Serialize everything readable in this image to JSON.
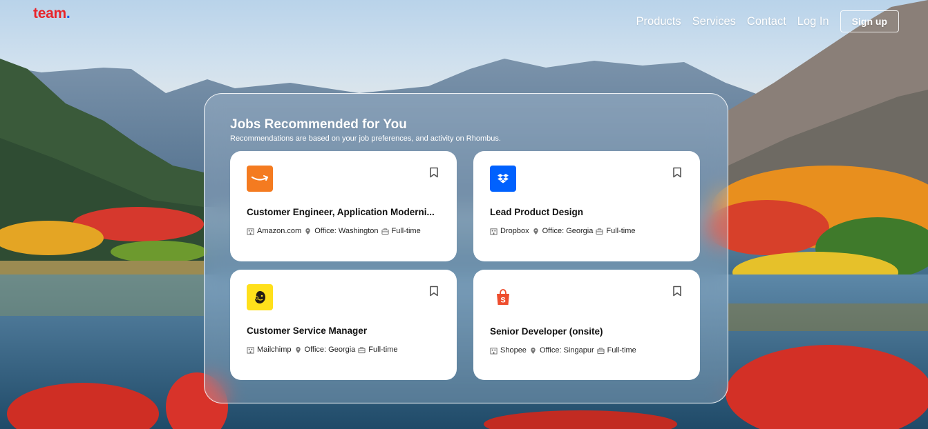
{
  "brand": {
    "name": "team",
    "dot": "."
  },
  "nav": {
    "items": [
      "Products",
      "Services",
      "Contact",
      "Log In"
    ],
    "signup": "Sign up"
  },
  "section": {
    "title": "Jobs Recommended for You",
    "subtitle": "Recommendations are based on your job preferences, and activity on Rhombus."
  },
  "jobs": [
    {
      "title": "Customer Engineer, Application Moderni...",
      "company": "Amazon.com",
      "location": "Office: Washington",
      "type": "Full-time",
      "logo": "amazon-logo-icon",
      "logo_bg": "#f47b20"
    },
    {
      "title": "Lead Product Design",
      "company": "Dropbox",
      "location": "Office: Georgia",
      "type": "Full-time",
      "logo": "dropbox-logo-icon",
      "logo_bg": "#0061fe"
    },
    {
      "title": "Customer Service Manager",
      "company": "Mailchimp",
      "location": "Office: Georgia",
      "type": "Full-time",
      "logo": "mailchimp-logo-icon",
      "logo_bg": "#ffe01b"
    },
    {
      "title": "Senior Developer (onsite)",
      "company": "Shopee",
      "location": "Office: Singapur",
      "type": "Full-time",
      "logo": "shopee-logo-icon",
      "logo_bg": "#ee4d2d"
    }
  ]
}
